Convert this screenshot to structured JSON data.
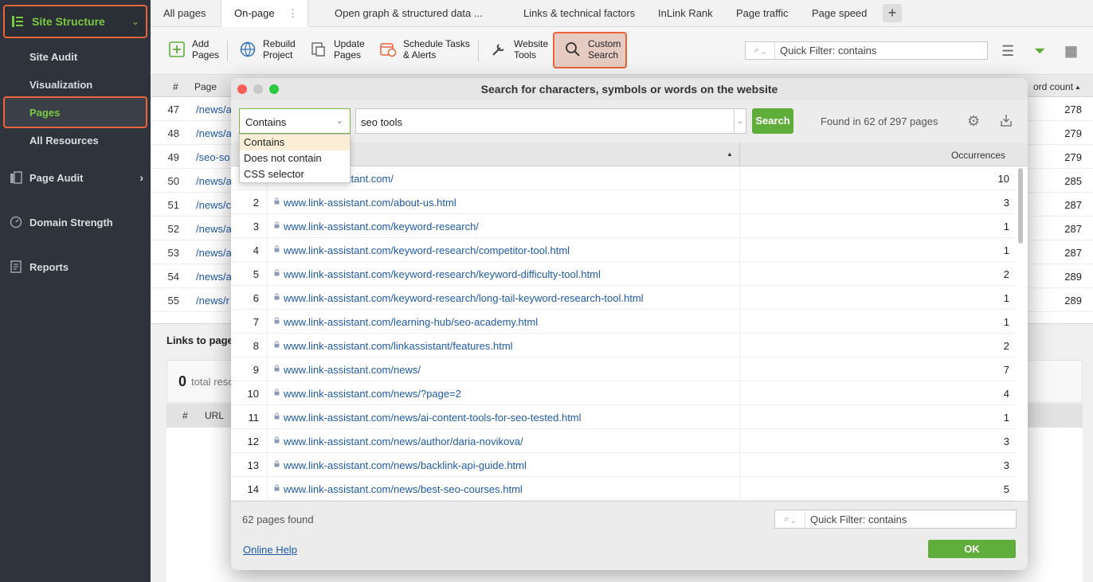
{
  "sidebar": {
    "header": "Site Structure",
    "subitems": [
      "Site Audit",
      "Visualization",
      "Pages",
      "All Resources"
    ],
    "sections": [
      "Page Audit",
      "Domain Strength",
      "Reports"
    ]
  },
  "tabs": [
    "All pages",
    "On-page",
    "Open graph & structured data ...",
    "Links & technical factors",
    "InLink Rank",
    "Page traffic",
    "Page speed"
  ],
  "tab_more": "⋮",
  "toolbar": {
    "add": [
      "Add",
      "Pages"
    ],
    "rebuild": [
      "Rebuild",
      "Project"
    ],
    "update": [
      "Update",
      "Pages"
    ],
    "schedule": [
      "Schedule Tasks",
      "& Alerts"
    ],
    "website": [
      "Website",
      "Tools"
    ],
    "custom": [
      "Custom",
      "Search"
    ],
    "quick_filter": "Quick Filter: contains"
  },
  "bg_table": {
    "col_num": "#",
    "col_page": "Page",
    "col_wordcount": "ord count",
    "rows": [
      {
        "n": "47",
        "u": "/news/a",
        "v": "278"
      },
      {
        "n": "48",
        "u": "/news/a",
        "v": "279"
      },
      {
        "n": "49",
        "u": "/seo-so",
        "v": "279"
      },
      {
        "n": "50",
        "u": "/news/a",
        "v": "285"
      },
      {
        "n": "51",
        "u": "/news/c",
        "v": "287"
      },
      {
        "n": "52",
        "u": "/news/a",
        "v": "287"
      },
      {
        "n": "53",
        "u": "/news/a",
        "v": "287"
      },
      {
        "n": "54",
        "u": "/news/a",
        "v": "289"
      },
      {
        "n": "55",
        "u": "/news/r",
        "v": "289"
      }
    ]
  },
  "lower_panel": {
    "title": "Links to page",
    "zero": "0",
    "total": "total reso",
    "col_num": "#",
    "col_url": "URL"
  },
  "modal": {
    "title": "Search for characters, symbols or words on the website",
    "condition": "Contains",
    "query": "seo tools",
    "search_button": "Search",
    "found": "Found in 62 of 297 pages",
    "options": [
      "Contains",
      "Does not contain",
      "CSS selector"
    ],
    "col_occurrences": "Occurrences",
    "rows": [
      {
        "n": "1",
        "u": "www.link-assistant.com/",
        "c": "10"
      },
      {
        "n": "2",
        "u": "www.link-assistant.com/about-us.html",
        "c": "3"
      },
      {
        "n": "3",
        "u": "www.link-assistant.com/keyword-research/",
        "c": "1"
      },
      {
        "n": "4",
        "u": "www.link-assistant.com/keyword-research/competitor-tool.html",
        "c": "1"
      },
      {
        "n": "5",
        "u": "www.link-assistant.com/keyword-research/keyword-difficulty-tool.html",
        "c": "2"
      },
      {
        "n": "6",
        "u": "www.link-assistant.com/keyword-research/long-tail-keyword-research-tool.html",
        "c": "1"
      },
      {
        "n": "7",
        "u": "www.link-assistant.com/learning-hub/seo-academy.html",
        "c": "1"
      },
      {
        "n": "8",
        "u": "www.link-assistant.com/linkassistant/features.html",
        "c": "2"
      },
      {
        "n": "9",
        "u": "www.link-assistant.com/news/",
        "c": "7"
      },
      {
        "n": "10",
        "u": "www.link-assistant.com/news/?page=2",
        "c": "4"
      },
      {
        "n": "11",
        "u": "www.link-assistant.com/news/ai-content-tools-for-seo-tested.html",
        "c": "1"
      },
      {
        "n": "12",
        "u": "www.link-assistant.com/news/author/daria-novikova/",
        "c": "3"
      },
      {
        "n": "13",
        "u": "www.link-assistant.com/news/backlink-api-guide.html",
        "c": "3"
      },
      {
        "n": "14",
        "u": "www.link-assistant.com/news/best-seo-courses.html",
        "c": "5"
      }
    ],
    "pages_found": "62 pages found",
    "quick_filter": "Quick Filter: contains",
    "help": "Online Help",
    "ok": "OK"
  },
  "colors": {
    "accent_green": "#5fae3b",
    "highlight_orange": "#e8643a",
    "link_blue": "#1f5aa6",
    "sidebar_bg": "#2f343c"
  }
}
